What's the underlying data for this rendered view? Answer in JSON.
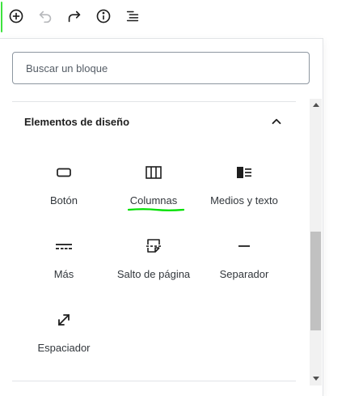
{
  "toolbar": {
    "buttons": [
      {
        "name": "add-block-button",
        "icon": "plus-circle-icon"
      },
      {
        "name": "undo-button",
        "icon": "undo-icon",
        "disabled": true
      },
      {
        "name": "redo-button",
        "icon": "redo-icon"
      },
      {
        "name": "info-button",
        "icon": "info-icon"
      },
      {
        "name": "outline-button",
        "icon": "list-outline-icon"
      }
    ],
    "active_indicator_color": "#3ee33e"
  },
  "inserter": {
    "search": {
      "placeholder": "Buscar un bloque",
      "value": ""
    },
    "section": {
      "title": "Elementos de diseño",
      "expanded": true,
      "toggle_icon": "chevron-up-icon",
      "blocks": [
        {
          "label": "Botón",
          "icon": "button-icon"
        },
        {
          "label": "Columnas",
          "icon": "columns-icon",
          "highlighted": true
        },
        {
          "label": "Medios y texto",
          "icon": "media-text-icon"
        },
        {
          "label": "Más",
          "icon": "more-icon"
        },
        {
          "label": "Salto de página",
          "icon": "page-break-icon"
        },
        {
          "label": "Separador",
          "icon": "separator-icon"
        },
        {
          "label": "Espaciador",
          "icon": "spacer-icon"
        }
      ]
    },
    "highlight_color": "#00e000"
  }
}
